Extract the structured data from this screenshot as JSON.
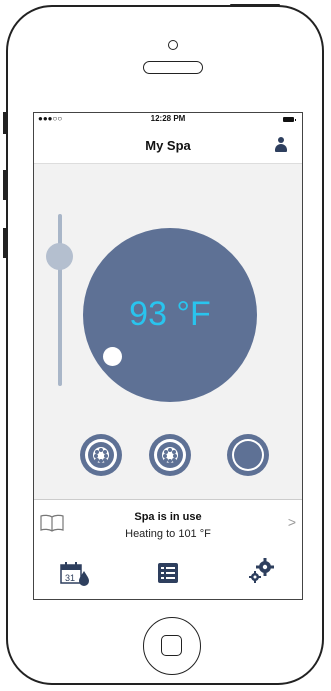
{
  "status_bar": {
    "signal": "●●●○○",
    "time": "12:28 PM"
  },
  "nav": {
    "title": "My Spa",
    "profile_icon": "user-icon"
  },
  "temperature": {
    "value": "93 °F",
    "slider_level": 0.8
  },
  "controls": [
    {
      "name": "jets-1",
      "icon": "jet-icon"
    },
    {
      "name": "jets-2",
      "icon": "jet-icon"
    },
    {
      "name": "light",
      "icon": "light-icon"
    }
  ],
  "spa_status": {
    "line1": "Spa is in use",
    "line2": "Heating to 101 °F",
    "icon": "book-icon"
  },
  "tabs": [
    {
      "name": "schedule",
      "icon": "calendar-icon",
      "label": "31"
    },
    {
      "name": "list",
      "icon": "list-icon"
    },
    {
      "name": "settings",
      "icon": "gears-icon"
    }
  ],
  "colors": {
    "dial": "#5e7195",
    "temp_text": "#29c4ee",
    "slider": "#a9b6c8",
    "icon_dark": "#2e3f5e"
  }
}
